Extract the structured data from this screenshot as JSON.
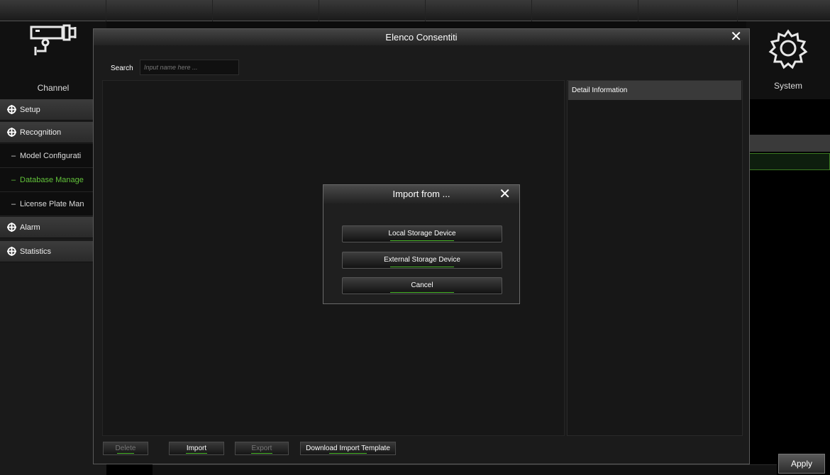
{
  "top_nav": {
    "channel_label": "Channel",
    "system_label": "System"
  },
  "sidebar": {
    "items": [
      {
        "label": "Setup"
      },
      {
        "label": "Recognition"
      },
      {
        "label": "Alarm"
      },
      {
        "label": "Statistics"
      }
    ],
    "subitems": [
      {
        "label": "Model Configurati"
      },
      {
        "label": "Database Manage"
      },
      {
        "label": "License Plate Man"
      }
    ]
  },
  "dialog": {
    "title": "Elenco Consentiti",
    "search_label": "Search",
    "search_placeholder": "Input name here ...",
    "detail_header": "Detail Information",
    "buttons": {
      "delete": "Delete",
      "import": "Import",
      "export": "Export",
      "download_template": "Download Import Template"
    }
  },
  "import_modal": {
    "title": "Import from ...",
    "local": "Local Storage Device",
    "external": "External Storage Device",
    "cancel": "Cancel"
  },
  "apply_label": "Apply",
  "colors": {
    "accent": "#62c23a",
    "background": "#1b1b1b"
  },
  "icons": [
    "camera-icon",
    "gear-icon",
    "close-icon",
    "crosshair-icon"
  ]
}
